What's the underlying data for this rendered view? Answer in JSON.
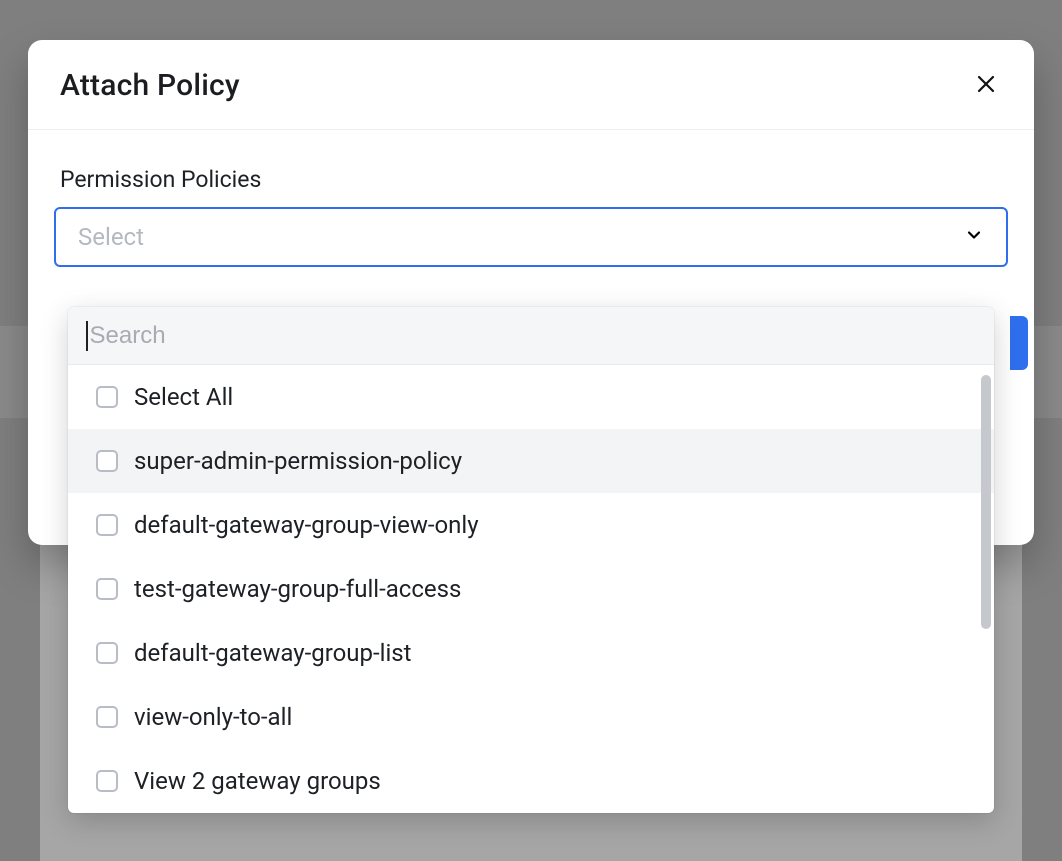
{
  "modal": {
    "title": "Attach Policy",
    "field_label": "Permission Policies",
    "select_placeholder": "Select"
  },
  "dropdown": {
    "search_placeholder": "Search",
    "search_value": "",
    "select_all_label": "Select All",
    "options": [
      "super-admin-permission-policy",
      "default-gateway-group-view-only",
      "test-gateway-group-full-access",
      "default-gateway-group-list",
      "view-only-to-all",
      "View 2 gateway groups"
    ],
    "highlighted_index": 0
  }
}
